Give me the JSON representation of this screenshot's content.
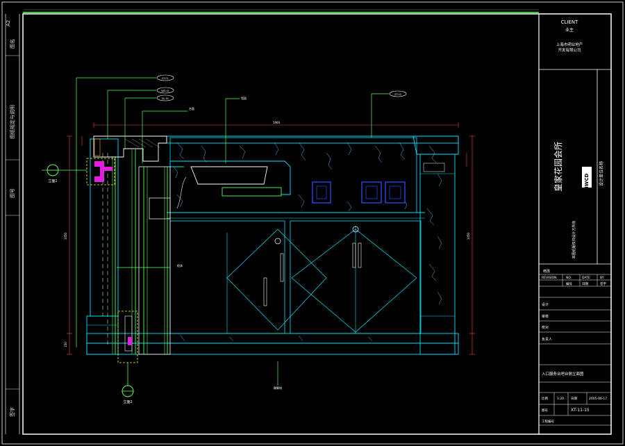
{
  "sheet_size": "A2",
  "side_labels": {
    "l1": "图名",
    "l2": "图纸规定与说明",
    "l3": "图号",
    "l4": "签字"
  },
  "title_block": {
    "client_label": "CLIENT",
    "client_sub": "业主",
    "client_name_1": "上海市明业地产",
    "client_name_2": "开发有限公司",
    "project_name": "皇家花园会所",
    "logo": "HWCD",
    "designer_info": "设计单位名称",
    "note_1": "本图纸版权归设计方所有",
    "revision_label": "REVISION",
    "revision_no": "NO.",
    "revision_date": "DATE",
    "revision_by": "BY",
    "revision_cn": "修改",
    "rev_cn_no": "编号",
    "rev_cn_date": "日期",
    "rev_cn_by": "签字",
    "drawing_title": "入口服务台吧台侧立面图",
    "scale_label": "比例",
    "scale_value": "1:20",
    "date_label": "日期",
    "date_value": "2005-06-17",
    "drawing_no_label": "图号",
    "drawing_no": "XT-11-15",
    "project_no_label": "工程编号",
    "sign_1": "设计",
    "sign_2": "审核",
    "sign_3": "校对",
    "sign_4": "负责人"
  },
  "annotations": {
    "tag_1": "ST-01",
    "tag_2": "WD-01",
    "tag_3": "GL-01",
    "tag_4": "ST-02",
    "section_left": "立面1",
    "section_bottom": "立面2",
    "dim_width": "1960",
    "dim_height_1": "1050",
    "dim_height_2": "150",
    "label_cabinet": "柜体",
    "label_bottom": "踢脚线",
    "label_top": "台面",
    "label_wall": "墙面"
  }
}
